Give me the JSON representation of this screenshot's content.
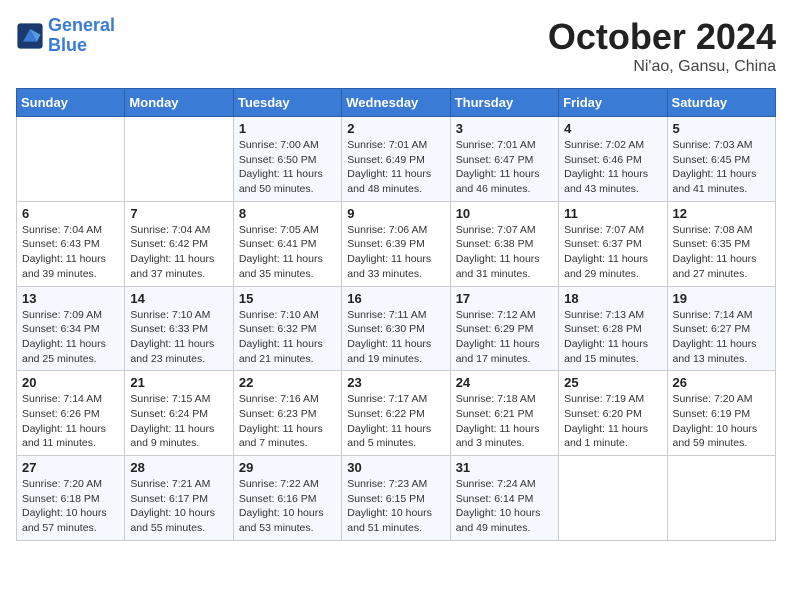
{
  "header": {
    "logo_line1": "General",
    "logo_line2": "Blue",
    "month_year": "October 2024",
    "location": "Ni'ao, Gansu, China"
  },
  "days_of_week": [
    "Sunday",
    "Monday",
    "Tuesday",
    "Wednesday",
    "Thursday",
    "Friday",
    "Saturday"
  ],
  "weeks": [
    [
      {
        "day": "",
        "info": ""
      },
      {
        "day": "",
        "info": ""
      },
      {
        "day": "1",
        "info": "Sunrise: 7:00 AM\nSunset: 6:50 PM\nDaylight: 11 hours and 50 minutes."
      },
      {
        "day": "2",
        "info": "Sunrise: 7:01 AM\nSunset: 6:49 PM\nDaylight: 11 hours and 48 minutes."
      },
      {
        "day": "3",
        "info": "Sunrise: 7:01 AM\nSunset: 6:47 PM\nDaylight: 11 hours and 46 minutes."
      },
      {
        "day": "4",
        "info": "Sunrise: 7:02 AM\nSunset: 6:46 PM\nDaylight: 11 hours and 43 minutes."
      },
      {
        "day": "5",
        "info": "Sunrise: 7:03 AM\nSunset: 6:45 PM\nDaylight: 11 hours and 41 minutes."
      }
    ],
    [
      {
        "day": "6",
        "info": "Sunrise: 7:04 AM\nSunset: 6:43 PM\nDaylight: 11 hours and 39 minutes."
      },
      {
        "day": "7",
        "info": "Sunrise: 7:04 AM\nSunset: 6:42 PM\nDaylight: 11 hours and 37 minutes."
      },
      {
        "day": "8",
        "info": "Sunrise: 7:05 AM\nSunset: 6:41 PM\nDaylight: 11 hours and 35 minutes."
      },
      {
        "day": "9",
        "info": "Sunrise: 7:06 AM\nSunset: 6:39 PM\nDaylight: 11 hours and 33 minutes."
      },
      {
        "day": "10",
        "info": "Sunrise: 7:07 AM\nSunset: 6:38 PM\nDaylight: 11 hours and 31 minutes."
      },
      {
        "day": "11",
        "info": "Sunrise: 7:07 AM\nSunset: 6:37 PM\nDaylight: 11 hours and 29 minutes."
      },
      {
        "day": "12",
        "info": "Sunrise: 7:08 AM\nSunset: 6:35 PM\nDaylight: 11 hours and 27 minutes."
      }
    ],
    [
      {
        "day": "13",
        "info": "Sunrise: 7:09 AM\nSunset: 6:34 PM\nDaylight: 11 hours and 25 minutes."
      },
      {
        "day": "14",
        "info": "Sunrise: 7:10 AM\nSunset: 6:33 PM\nDaylight: 11 hours and 23 minutes."
      },
      {
        "day": "15",
        "info": "Sunrise: 7:10 AM\nSunset: 6:32 PM\nDaylight: 11 hours and 21 minutes."
      },
      {
        "day": "16",
        "info": "Sunrise: 7:11 AM\nSunset: 6:30 PM\nDaylight: 11 hours and 19 minutes."
      },
      {
        "day": "17",
        "info": "Sunrise: 7:12 AM\nSunset: 6:29 PM\nDaylight: 11 hours and 17 minutes."
      },
      {
        "day": "18",
        "info": "Sunrise: 7:13 AM\nSunset: 6:28 PM\nDaylight: 11 hours and 15 minutes."
      },
      {
        "day": "19",
        "info": "Sunrise: 7:14 AM\nSunset: 6:27 PM\nDaylight: 11 hours and 13 minutes."
      }
    ],
    [
      {
        "day": "20",
        "info": "Sunrise: 7:14 AM\nSunset: 6:26 PM\nDaylight: 11 hours and 11 minutes."
      },
      {
        "day": "21",
        "info": "Sunrise: 7:15 AM\nSunset: 6:24 PM\nDaylight: 11 hours and 9 minutes."
      },
      {
        "day": "22",
        "info": "Sunrise: 7:16 AM\nSunset: 6:23 PM\nDaylight: 11 hours and 7 minutes."
      },
      {
        "day": "23",
        "info": "Sunrise: 7:17 AM\nSunset: 6:22 PM\nDaylight: 11 hours and 5 minutes."
      },
      {
        "day": "24",
        "info": "Sunrise: 7:18 AM\nSunset: 6:21 PM\nDaylight: 11 hours and 3 minutes."
      },
      {
        "day": "25",
        "info": "Sunrise: 7:19 AM\nSunset: 6:20 PM\nDaylight: 11 hours and 1 minute."
      },
      {
        "day": "26",
        "info": "Sunrise: 7:20 AM\nSunset: 6:19 PM\nDaylight: 10 hours and 59 minutes."
      }
    ],
    [
      {
        "day": "27",
        "info": "Sunrise: 7:20 AM\nSunset: 6:18 PM\nDaylight: 10 hours and 57 minutes."
      },
      {
        "day": "28",
        "info": "Sunrise: 7:21 AM\nSunset: 6:17 PM\nDaylight: 10 hours and 55 minutes."
      },
      {
        "day": "29",
        "info": "Sunrise: 7:22 AM\nSunset: 6:16 PM\nDaylight: 10 hours and 53 minutes."
      },
      {
        "day": "30",
        "info": "Sunrise: 7:23 AM\nSunset: 6:15 PM\nDaylight: 10 hours and 51 minutes."
      },
      {
        "day": "31",
        "info": "Sunrise: 7:24 AM\nSunset: 6:14 PM\nDaylight: 10 hours and 49 minutes."
      },
      {
        "day": "",
        "info": ""
      },
      {
        "day": "",
        "info": ""
      }
    ]
  ]
}
